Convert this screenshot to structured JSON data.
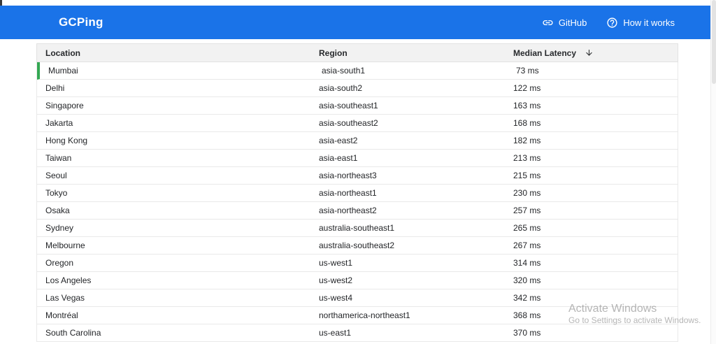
{
  "header": {
    "title": "GCPing",
    "links": [
      {
        "label": "GitHub",
        "icon": "link-icon"
      },
      {
        "label": "How it works",
        "icon": "help-icon"
      }
    ]
  },
  "table": {
    "columns": [
      "Location",
      "Region",
      "Median Latency"
    ],
    "sort": {
      "column": "Median Latency",
      "direction": "descending"
    },
    "rows": [
      {
        "location": "Mumbai",
        "region": "asia-south1",
        "latency": "73 ms",
        "fastest": true
      },
      {
        "location": "Delhi",
        "region": "asia-south2",
        "latency": "122 ms",
        "fastest": false
      },
      {
        "location": "Singapore",
        "region": "asia-southeast1",
        "latency": "163 ms",
        "fastest": false
      },
      {
        "location": "Jakarta",
        "region": "asia-southeast2",
        "latency": "168 ms",
        "fastest": false
      },
      {
        "location": "Hong Kong",
        "region": "asia-east2",
        "latency": "182 ms",
        "fastest": false
      },
      {
        "location": "Taiwan",
        "region": "asia-east1",
        "latency": "213 ms",
        "fastest": false
      },
      {
        "location": "Seoul",
        "region": "asia-northeast3",
        "latency": "215 ms",
        "fastest": false
      },
      {
        "location": "Tokyo",
        "region": "asia-northeast1",
        "latency": "230 ms",
        "fastest": false
      },
      {
        "location": "Osaka",
        "region": "asia-northeast2",
        "latency": "257 ms",
        "fastest": false
      },
      {
        "location": "Sydney",
        "region": "australia-southeast1",
        "latency": "265 ms",
        "fastest": false
      },
      {
        "location": "Melbourne",
        "region": "australia-southeast2",
        "latency": "267 ms",
        "fastest": false
      },
      {
        "location": "Oregon",
        "region": "us-west1",
        "latency": "314 ms",
        "fastest": false
      },
      {
        "location": "Los Angeles",
        "region": "us-west2",
        "latency": "320 ms",
        "fastest": false
      },
      {
        "location": "Las Vegas",
        "region": "us-west4",
        "latency": "342 ms",
        "fastest": false
      },
      {
        "location": "Montréal",
        "region": "northamerica-northeast1",
        "latency": "368 ms",
        "fastest": false
      },
      {
        "location": "South Carolina",
        "region": "us-east1",
        "latency": "370 ms",
        "fastest": false
      }
    ]
  },
  "watermark": {
    "line1": "Activate Windows",
    "line2": "Go to Settings to activate Windows."
  },
  "colors": {
    "header_blue": "#1a73e8",
    "fastest_green": "#34a853",
    "table_header_bg": "#f2f2f2",
    "row_border": "#e9e9e9",
    "text": "#232528"
  }
}
